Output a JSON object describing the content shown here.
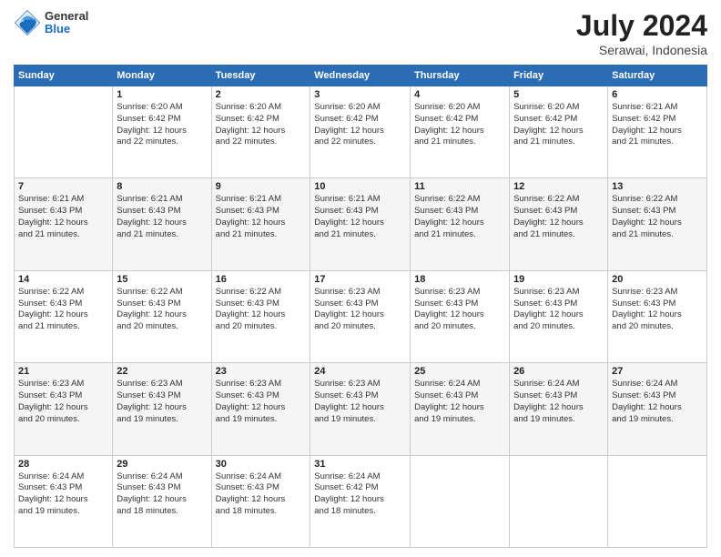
{
  "header": {
    "logo": {
      "general": "General",
      "blue": "Blue"
    },
    "title": "July 2024",
    "location": "Serawai, Indonesia"
  },
  "calendar": {
    "days_of_week": [
      "Sunday",
      "Monday",
      "Tuesday",
      "Wednesday",
      "Thursday",
      "Friday",
      "Saturday"
    ],
    "weeks": [
      [
        {
          "day": "",
          "info": ""
        },
        {
          "day": "1",
          "info": "Sunrise: 6:20 AM\nSunset: 6:42 PM\nDaylight: 12 hours\nand 22 minutes."
        },
        {
          "day": "2",
          "info": "Sunrise: 6:20 AM\nSunset: 6:42 PM\nDaylight: 12 hours\nand 22 minutes."
        },
        {
          "day": "3",
          "info": "Sunrise: 6:20 AM\nSunset: 6:42 PM\nDaylight: 12 hours\nand 22 minutes."
        },
        {
          "day": "4",
          "info": "Sunrise: 6:20 AM\nSunset: 6:42 PM\nDaylight: 12 hours\nand 21 minutes."
        },
        {
          "day": "5",
          "info": "Sunrise: 6:20 AM\nSunset: 6:42 PM\nDaylight: 12 hours\nand 21 minutes."
        },
        {
          "day": "6",
          "info": "Sunrise: 6:21 AM\nSunset: 6:42 PM\nDaylight: 12 hours\nand 21 minutes."
        }
      ],
      [
        {
          "day": "7",
          "info": "Sunrise: 6:21 AM\nSunset: 6:43 PM\nDaylight: 12 hours\nand 21 minutes."
        },
        {
          "day": "8",
          "info": "Sunrise: 6:21 AM\nSunset: 6:43 PM\nDaylight: 12 hours\nand 21 minutes."
        },
        {
          "day": "9",
          "info": "Sunrise: 6:21 AM\nSunset: 6:43 PM\nDaylight: 12 hours\nand 21 minutes."
        },
        {
          "day": "10",
          "info": "Sunrise: 6:21 AM\nSunset: 6:43 PM\nDaylight: 12 hours\nand 21 minutes."
        },
        {
          "day": "11",
          "info": "Sunrise: 6:22 AM\nSunset: 6:43 PM\nDaylight: 12 hours\nand 21 minutes."
        },
        {
          "day": "12",
          "info": "Sunrise: 6:22 AM\nSunset: 6:43 PM\nDaylight: 12 hours\nand 21 minutes."
        },
        {
          "day": "13",
          "info": "Sunrise: 6:22 AM\nSunset: 6:43 PM\nDaylight: 12 hours\nand 21 minutes."
        }
      ],
      [
        {
          "day": "14",
          "info": "Sunrise: 6:22 AM\nSunset: 6:43 PM\nDaylight: 12 hours\nand 21 minutes."
        },
        {
          "day": "15",
          "info": "Sunrise: 6:22 AM\nSunset: 6:43 PM\nDaylight: 12 hours\nand 20 minutes."
        },
        {
          "day": "16",
          "info": "Sunrise: 6:22 AM\nSunset: 6:43 PM\nDaylight: 12 hours\nand 20 minutes."
        },
        {
          "day": "17",
          "info": "Sunrise: 6:23 AM\nSunset: 6:43 PM\nDaylight: 12 hours\nand 20 minutes."
        },
        {
          "day": "18",
          "info": "Sunrise: 6:23 AM\nSunset: 6:43 PM\nDaylight: 12 hours\nand 20 minutes."
        },
        {
          "day": "19",
          "info": "Sunrise: 6:23 AM\nSunset: 6:43 PM\nDaylight: 12 hours\nand 20 minutes."
        },
        {
          "day": "20",
          "info": "Sunrise: 6:23 AM\nSunset: 6:43 PM\nDaylight: 12 hours\nand 20 minutes."
        }
      ],
      [
        {
          "day": "21",
          "info": "Sunrise: 6:23 AM\nSunset: 6:43 PM\nDaylight: 12 hours\nand 20 minutes."
        },
        {
          "day": "22",
          "info": "Sunrise: 6:23 AM\nSunset: 6:43 PM\nDaylight: 12 hours\nand 19 minutes."
        },
        {
          "day": "23",
          "info": "Sunrise: 6:23 AM\nSunset: 6:43 PM\nDaylight: 12 hours\nand 19 minutes."
        },
        {
          "day": "24",
          "info": "Sunrise: 6:23 AM\nSunset: 6:43 PM\nDaylight: 12 hours\nand 19 minutes."
        },
        {
          "day": "25",
          "info": "Sunrise: 6:24 AM\nSunset: 6:43 PM\nDaylight: 12 hours\nand 19 minutes."
        },
        {
          "day": "26",
          "info": "Sunrise: 6:24 AM\nSunset: 6:43 PM\nDaylight: 12 hours\nand 19 minutes."
        },
        {
          "day": "27",
          "info": "Sunrise: 6:24 AM\nSunset: 6:43 PM\nDaylight: 12 hours\nand 19 minutes."
        }
      ],
      [
        {
          "day": "28",
          "info": "Sunrise: 6:24 AM\nSunset: 6:43 PM\nDaylight: 12 hours\nand 19 minutes."
        },
        {
          "day": "29",
          "info": "Sunrise: 6:24 AM\nSunset: 6:43 PM\nDaylight: 12 hours\nand 18 minutes."
        },
        {
          "day": "30",
          "info": "Sunrise: 6:24 AM\nSunset: 6:43 PM\nDaylight: 12 hours\nand 18 minutes."
        },
        {
          "day": "31",
          "info": "Sunrise: 6:24 AM\nSunset: 6:42 PM\nDaylight: 12 hours\nand 18 minutes."
        },
        {
          "day": "",
          "info": ""
        },
        {
          "day": "",
          "info": ""
        },
        {
          "day": "",
          "info": ""
        }
      ]
    ]
  }
}
